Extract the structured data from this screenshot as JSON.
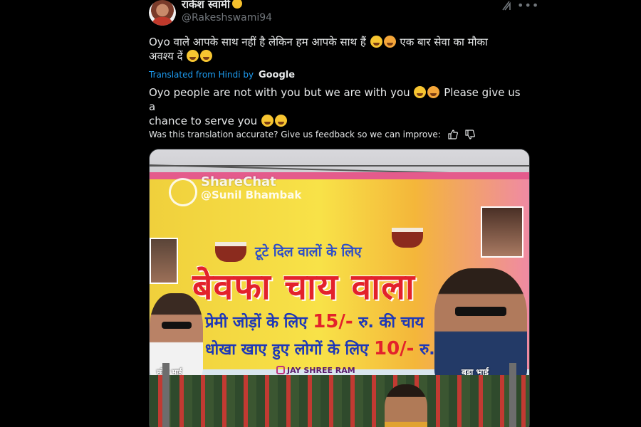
{
  "author": {
    "display_name": "राकेश स्वामी",
    "handle": "@Rakeshswami94"
  },
  "header_icons": {
    "grok": "grok-icon",
    "more": "more-icon"
  },
  "tweet": {
    "original_text": "Oyo वाले आपके साथ नहीं है लेकिन हम आपके साथ हैं",
    "original_text_2": "एक बार सेवा का मौका",
    "original_text_3": "अवश्य दें",
    "translated_prefix": "Translated from Hindi by",
    "translated_by": "Google",
    "translated_text": "Oyo people are not with you but we are with you",
    "translated_text_2": "Please give us a",
    "translated_text_3": "chance to serve you",
    "feedback_prompt": "Was this translation accurate? Give us feedback so we can improve:"
  },
  "media": {
    "watermark_brand": "ShareChat",
    "watermark_user": "@Sunil Bhambak",
    "banner_tagline": "टूटे दिल वालों के लिए",
    "banner_headline": "बेवफा चाय वाला",
    "price_line_1_label": "प्रेमी जोड़ों के लिए",
    "price_line_1_price": "15/-",
    "price_line_1_suffix": "रु. की चाय",
    "price_line_2_label": "धोखा खाए हुए लोगों के लिए",
    "price_line_2_price": "10/-",
    "price_line_2_suffix": "रु. की चाय",
    "instagram_handle": "JAY SHREE RAM",
    "caption_left": "छोटा भाई",
    "caption_right": "बड़ा भाई"
  },
  "colors": {
    "background": "#000000",
    "link_blue": "#1d9bf0",
    "muted": "#71767b",
    "text": "#e7e9ea"
  }
}
